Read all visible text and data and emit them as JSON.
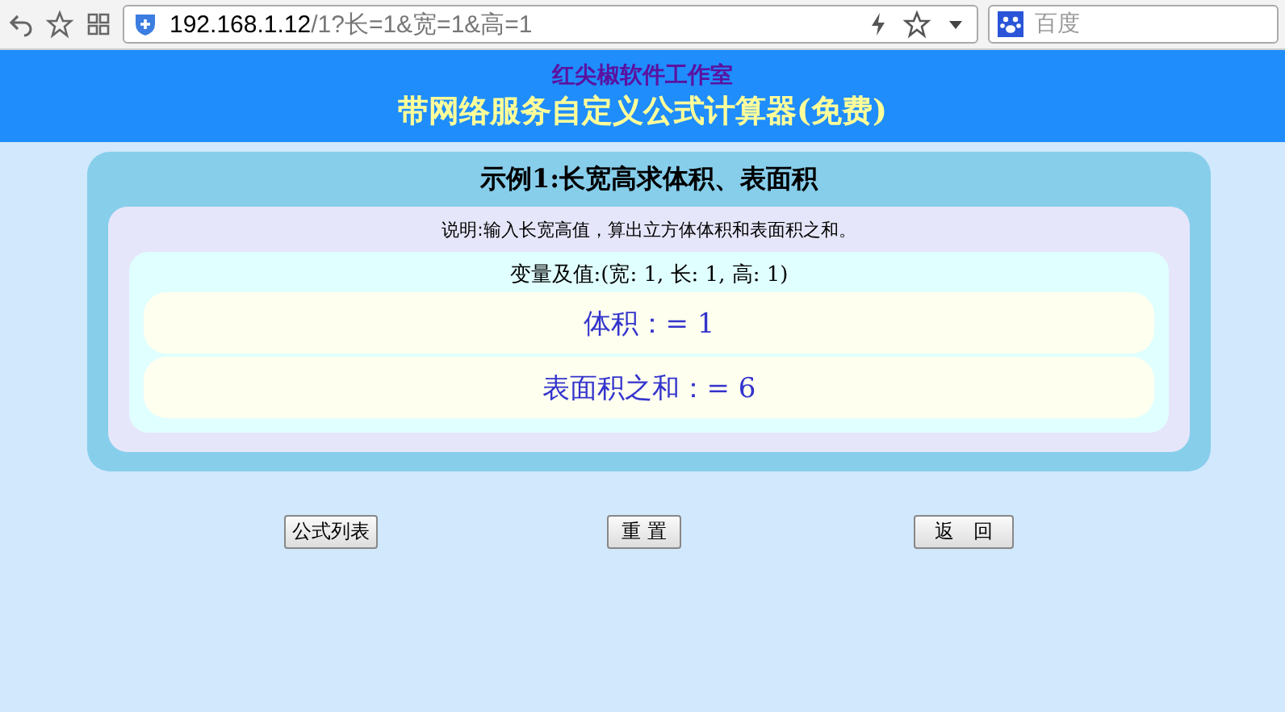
{
  "browser": {
    "url_host": "192.168.1.12",
    "url_rest": "/1?长=1&宽=1&高=1",
    "search_placeholder": "百度"
  },
  "header": {
    "studio": "红尖椒软件工作室",
    "title": "带网络服务自定义公式计算器(免费)"
  },
  "example": {
    "title": "示例1:长宽高求体积、表面积",
    "description": "说明:输入长宽高值，算出立方体体积和表面积之和。",
    "variables": "变量及值:(宽: 1, 长: 1, 高: 1)",
    "results": [
      "体积：= 1",
      "表面积之和：= 6"
    ]
  },
  "buttons": [
    "公式列表",
    "重 置",
    "返　回"
  ]
}
